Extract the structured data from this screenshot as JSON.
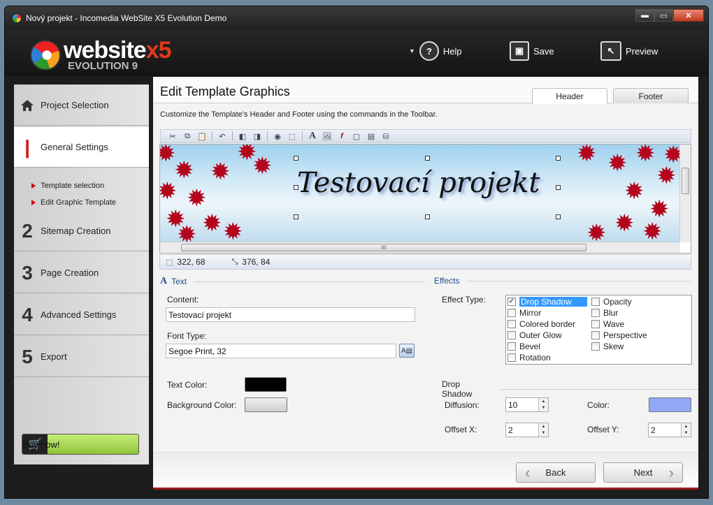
{
  "window": {
    "title": "Nový projekt - Incomedia WebSite X5 Evolution Demo",
    "min": "▬",
    "max": "▭",
    "close": "✕"
  },
  "logo": {
    "brand": "website",
    "brand_x5": "x5",
    "edition": "EVOLUTION 9"
  },
  "top": {
    "help": "Help",
    "save": "Save",
    "preview": "Preview"
  },
  "sidebar": {
    "items": [
      {
        "num": "",
        "label": "Project Selection"
      },
      {
        "num": "",
        "label": "General Settings"
      },
      {
        "num": "2",
        "label": "Sitemap Creation"
      },
      {
        "num": "3",
        "label": "Page Creation"
      },
      {
        "num": "4",
        "label": "Advanced Settings"
      },
      {
        "num": "5",
        "label": "Export"
      }
    ],
    "sub": [
      "Template selection",
      "Edit Graphic Template"
    ],
    "buy": "Buy now!"
  },
  "main": {
    "title": "Edit Template Graphics",
    "tabs": [
      "Header",
      "Footer"
    ],
    "description": "Customize the Template's Header and Footer using the commands in the Toolbar.",
    "header_text": "Testovací projekt",
    "coords": {
      "position": "322, 68",
      "size": "376, 84"
    }
  },
  "text_section": {
    "title": "Text",
    "content_label": "Content:",
    "content_value": "Testovací projekt",
    "font_label": "Font Type:",
    "font_value": "Segoe Print, 32",
    "text_color_label": "Text Color:",
    "bg_color_label": "Background Color:",
    "text_color": "#000000",
    "bg_color": "#dcdcdc"
  },
  "effects": {
    "title": "Effects",
    "type_label": "Effect Type:",
    "col1": [
      "Drop Shadow",
      "Mirror",
      "Colored border",
      "Outer Glow",
      "Bevel",
      "Rotation"
    ],
    "col2": [
      "Opacity",
      "Blur",
      "Wave",
      "Perspective",
      "Skew"
    ],
    "checked_mark": "✓"
  },
  "drop_shadow": {
    "title": "Drop Shadow",
    "diffusion_label": "Diffusion:",
    "diffusion": "10",
    "color_label": "Color:",
    "color": "#90a8f5",
    "offset_x_label": "Offset X:",
    "offset_x": "2",
    "offset_y_label": "Offset Y:",
    "offset_y": "2"
  },
  "nav": {
    "back": "Back",
    "next": "Next"
  }
}
